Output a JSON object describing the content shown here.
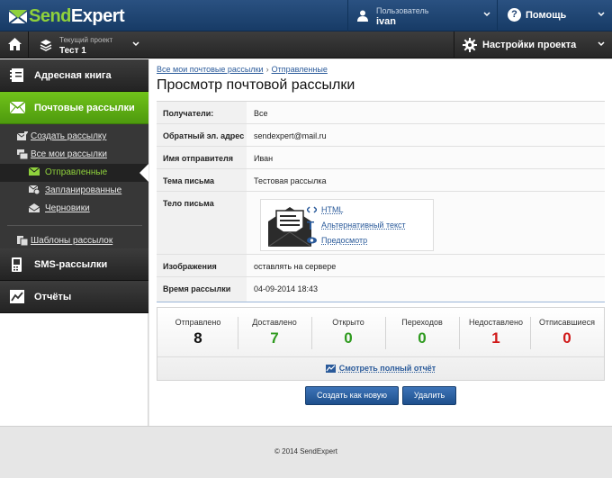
{
  "app": {
    "logo_send": "Send",
    "logo_expert": "Expert"
  },
  "topbar": {
    "user_caption": "Пользователь",
    "user_name": "ivan",
    "help_label": "Помощь",
    "help_glyph": "?"
  },
  "projectbar": {
    "project_caption": "Текущий проект",
    "project_name": "Тест 1",
    "settings_label": "Настройки проекта"
  },
  "sidebar": {
    "items": [
      {
        "label": "Адресная книга",
        "icon": "address-book-icon"
      },
      {
        "label": "Почтовые рассылки",
        "icon": "envelope-icon",
        "active": true
      },
      {
        "label": "SMS-рассылки",
        "icon": "phone-icon"
      },
      {
        "label": "Отчёты",
        "icon": "chart-icon"
      }
    ],
    "sub": [
      {
        "label": "Создать рассылку",
        "icon": "create-mail-icon"
      },
      {
        "label": "Все мои рассылки",
        "icon": "all-mail-icon"
      },
      {
        "label": "Отправленные",
        "icon": "sent-icon",
        "selected": true
      },
      {
        "label": "Запланированные",
        "icon": "scheduled-icon"
      },
      {
        "label": "Черновики",
        "icon": "drafts-icon"
      },
      {
        "label": "Шаблоны рассылок",
        "icon": "templates-icon"
      }
    ]
  },
  "breadcrumb": {
    "root": "Все мои почтовые рассылки",
    "sep": "›",
    "current": "Отправленные"
  },
  "page_title": "Просмотр почтовой рассылки",
  "details": {
    "recipients_label": "Получатели:",
    "recipients_value": "Все",
    "reply_label": "Обратный эл. адрес",
    "reply_value": "sendexpert@mail.ru",
    "sender_label": "Имя отправителя",
    "sender_value": "Иван",
    "subject_label": "Тема письма",
    "subject_value": "Тестовая рассылка",
    "body_label": "Тело письма",
    "body_links": {
      "html": "HTML",
      "alt": "Альтернативный текст",
      "preview": "Предосмотр"
    },
    "images_label": "Изображения",
    "images_value": "оставлять на сервере",
    "time_label": "Время рассылки",
    "time_value": "04-09-2014 18:43"
  },
  "stats": [
    {
      "label": "Отправлено",
      "value": "8",
      "color": "#111111"
    },
    {
      "label": "Доставлено",
      "value": "7",
      "color": "#2e9a1e"
    },
    {
      "label": "Открыто",
      "value": "0",
      "color": "#2e9a1e"
    },
    {
      "label": "Переходов",
      "value": "0",
      "color": "#2e9a1e"
    },
    {
      "label": "Недоставлено",
      "value": "1",
      "color": "#d01818"
    },
    {
      "label": "Отписавшиеся",
      "value": "0",
      "color": "#d01818"
    }
  ],
  "report_link": "Смотреть полный отчёт",
  "buttons": {
    "create_new": "Создать как новую",
    "delete": "Удалить"
  },
  "footer": "© 2014 SendExpert"
}
